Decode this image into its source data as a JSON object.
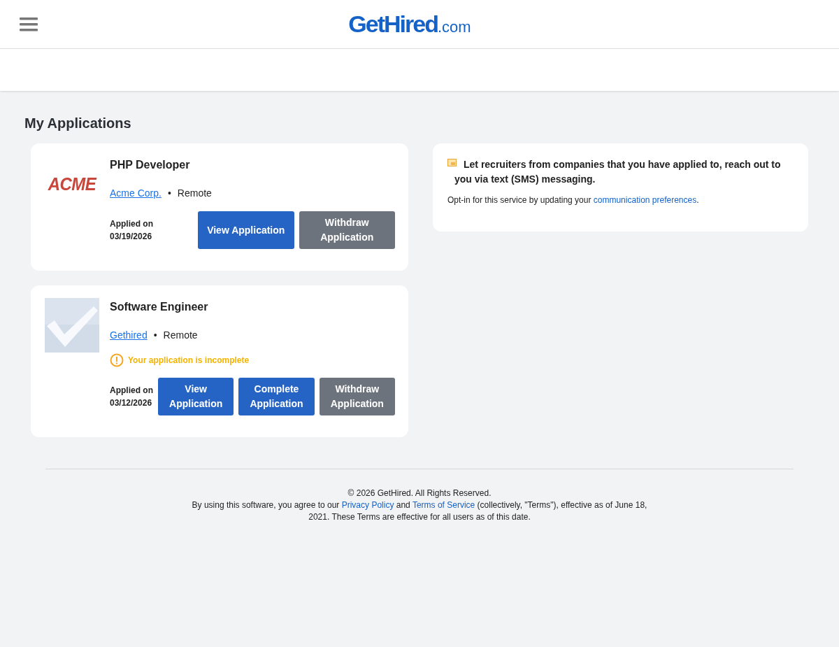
{
  "header": {
    "logo": {
      "name": "GetHired",
      "suffix": ".com"
    }
  },
  "page_title": "My Applications",
  "applications": [
    {
      "logo": {
        "kind": "text",
        "text": "ACME"
      },
      "title": "PHP Developer",
      "company": "Acme Corp.",
      "separator": "•",
      "location": "Remote",
      "applied": "Applied on 03/19/2026",
      "buttons": [
        {
          "label": "View Application",
          "kind": "primary"
        },
        {
          "label": "Withdraw Application",
          "kind": "secondary"
        }
      ]
    },
    {
      "logo": {
        "kind": "placeholder"
      },
      "title": "Software Engineer",
      "company": "Gethired",
      "separator": "•",
      "location": "Remote",
      "warning": "Your application is incomplete",
      "applied": "Applied on 03/12/2026",
      "buttons": [
        {
          "label": "View Application",
          "kind": "primary"
        },
        {
          "label": "Complete Application",
          "kind": "primary"
        },
        {
          "label": "Withdraw Application",
          "kind": "secondary"
        }
      ]
    }
  ],
  "sms_card": {
    "heading": "Let recruiters from companies that you have applied to, reach out to you via text (SMS) messaging.",
    "text_before": "Opt-in for this service by updating your",
    "link": "communication preferences",
    "text_after": "."
  },
  "footer": {
    "copyright": "© 2026 GetHired. All Rights Reserved.",
    "parts": [
      {
        "kind": "text",
        "text": "By using this software, you agree to our "
      },
      {
        "kind": "link",
        "text": "Privacy Policy"
      },
      {
        "kind": "text",
        "text": " and "
      },
      {
        "kind": "link",
        "text": "Terms of Service"
      },
      {
        "kind": "text",
        "text": " (collectively, \"Terms\"), effective as of June 18, 2021. These Terms are effective for all users as of this date."
      }
    ]
  }
}
